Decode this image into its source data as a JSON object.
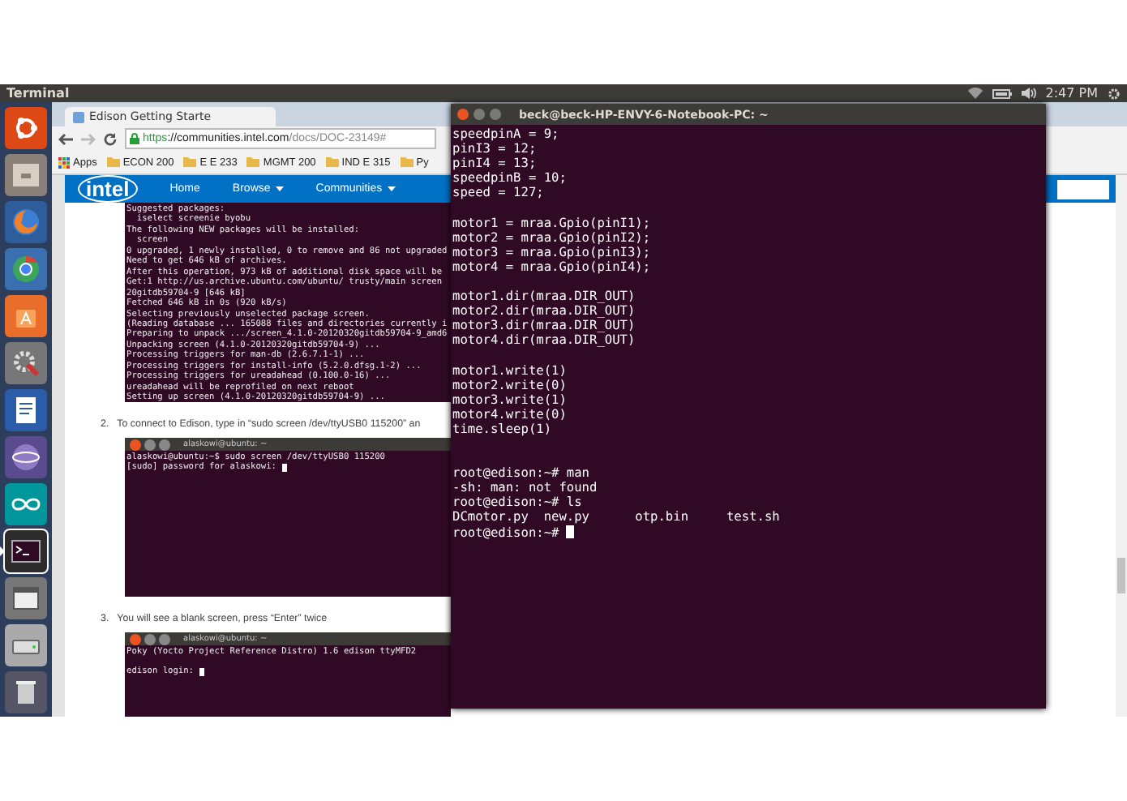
{
  "top_bar": {
    "app_title": "Terminal",
    "clock": "2:47 PM"
  },
  "launcher": [
    {
      "kind": "ubuntu",
      "selected": false
    },
    {
      "kind": "files",
      "selected": false
    },
    {
      "kind": "firefox",
      "selected": false
    },
    {
      "kind": "chrome",
      "selected": false
    },
    {
      "kind": "software",
      "selected": false
    },
    {
      "kind": "settings",
      "selected": false
    },
    {
      "kind": "writer",
      "selected": false
    },
    {
      "kind": "sphere",
      "selected": false
    },
    {
      "kind": "arduino",
      "selected": false
    },
    {
      "kind": "terminal",
      "selected": true
    },
    {
      "kind": "window",
      "selected": false
    },
    {
      "kind": "drive",
      "selected": false
    },
    {
      "kind": "trash",
      "selected": false
    }
  ],
  "browser": {
    "tab": {
      "title": "Edison Getting Starte"
    },
    "url": {
      "scheme": "https",
      "host": "://communities.intel.com",
      "path": "/docs/DOC-23149#"
    },
    "apps_label": "Apps",
    "bookmarks": [
      "ECON 200",
      "E E 233",
      "MGMT 200",
      "IND E 315",
      "Py"
    ],
    "site": {
      "logo": "intel",
      "nav": [
        {
          "label": "Home",
          "dropdown": false
        },
        {
          "label": "Browse",
          "dropdown": true
        },
        {
          "label": "Communities",
          "dropdown": true
        }
      ]
    },
    "content": [
      {
        "kind": "console",
        "blocks": [
          [
            "Suggested packages:",
            "  iselect screenie byobu",
            "The following NEW packages will be installed:",
            "  screen",
            "0 upgraded, 1 newly installed, 0 to remove and 86 not upgraded",
            "Need to get 646 kB of archives.",
            "After this operation, 973 kB of additional disk space will be",
            "Get:1 http://us.archive.ubuntu.com/ubuntu/ trusty/main screen",
            "20gitdb59704-9 [646 kB]",
            "Fetched 646 kB in 0s (920 kB/s)",
            "Selecting previously unselected package screen.",
            "(Reading database ... 165088 files and directories currently i",
            "Preparing to unpack .../screen_4.1.0-20120320gitdb59704-9_amd6",
            "Unpacking screen (4.1.0-20120320gitdb59704-9) ...",
            "Processing triggers for man-db (2.6.7.1-1) ...",
            "Processing triggers for install-info (5.2.0.dfsg.1-2) ...",
            "Processing triggers for ureadahead (0.100.0-16) ...",
            "ureadahead will be reprofiled on next reboot",
            "Setting up screen (4.1.0-20120320gitdb59704-9) ..."
          ]
        ],
        "cursor": false
      },
      {
        "kind": "step",
        "number": "2.",
        "text": "To connect to Edison, type in “sudo screen /dev/ttyUSB0 115200” an"
      },
      {
        "kind": "console",
        "title": "alaskowi@ubuntu: ~",
        "blocks": [
          [
            "alaskowi@ubuntu:~$ sudo screen /dev/ttyUSB0 115200",
            "[sudo] password for alaskowi: "
          ]
        ],
        "cursor": true
      },
      {
        "kind": "step",
        "number": "3.",
        "text": "You will see a blank screen, press “Enter” twice"
      },
      {
        "kind": "console",
        "title": "alaskowi@ubuntu: ~",
        "blocks": [
          [
            "Poky (Yocto Project Reference Distro) 1.6 edison ttyMFD2"
          ],
          [
            "edison login: "
          ]
        ],
        "cursor": true
      }
    ]
  },
  "terminal": {
    "title": "beck@beck-HP-ENVY-6-Notebook-PC: ~",
    "blocks": [
      [
        "speedpinA = 9;",
        "pinI3 = 12;",
        "pinI4 = 13;",
        "speedpinB = 10;",
        "speed = 127;"
      ],
      [
        "motor1 = mraa.Gpio(pinI1);",
        "motor2 = mraa.Gpio(pinI2);",
        "motor3 = mraa.Gpio(pinI3);",
        "motor4 = mraa.Gpio(pinI4);"
      ],
      [
        "motor1.dir(mraa.DIR_OUT)",
        "motor2.dir(mraa.DIR_OUT)",
        "motor3.dir(mraa.DIR_OUT)",
        "motor4.dir(mraa.DIR_OUT)"
      ],
      [
        "motor1.write(1)",
        "motor2.write(0)",
        "motor3.write(1)",
        "motor4.write(0)",
        "time.sleep(1)"
      ]
    ],
    "session": [
      "root@edison:~# man",
      "-sh: man: not found",
      "root@edison:~# ls",
      "DCmotor.py  new.py      otp.bin     test.sh",
      "root@edison:~# "
    ],
    "cursor": true
  }
}
